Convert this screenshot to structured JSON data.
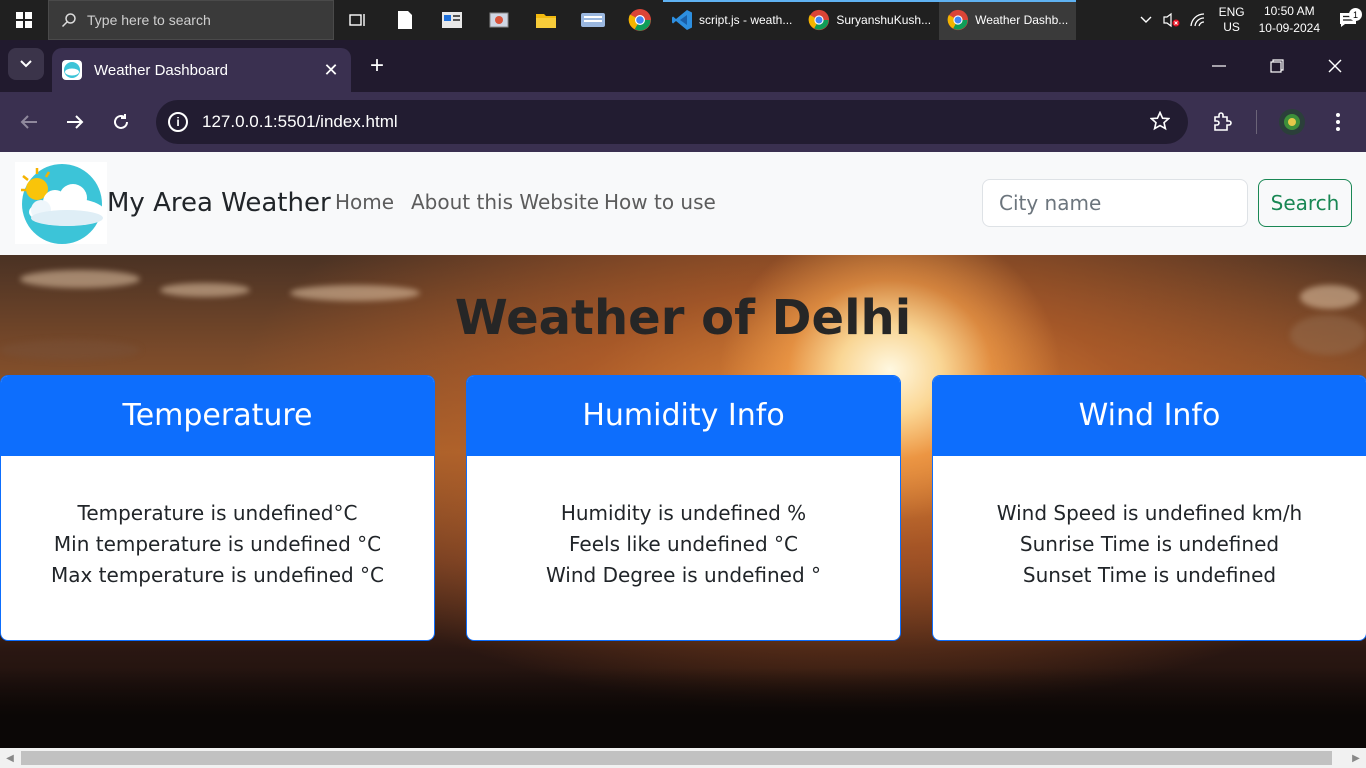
{
  "taskbar": {
    "search_placeholder": "Type here to search",
    "apps": [
      {
        "label": "script.js - weath..."
      },
      {
        "label": "SuryanshuKush..."
      },
      {
        "label": "Weather Dashb..."
      }
    ],
    "lang_line1": "ENG",
    "lang_line2": "US",
    "time": "10:50 AM",
    "date": "10-09-2024",
    "notification_count": "1"
  },
  "browser": {
    "tab_title": "Weather Dashboard",
    "url": "127.0.0.1:5501/index.html"
  },
  "navbar": {
    "brand": "My Area Weather",
    "links": [
      "Home",
      "About this Website",
      "How to use"
    ],
    "search_placeholder": "City name",
    "search_button": "Search"
  },
  "hero": {
    "title": "Weather of Delhi"
  },
  "cards": [
    {
      "header": "Temperature",
      "lines": [
        "Temperature is undefined°C",
        "Min temperature is undefined °C",
        "Max temperature is undefined °C"
      ]
    },
    {
      "header": "Humidity Info",
      "lines": [
        "Humidity is undefined %",
        "Feels like undefined °C",
        "Wind Degree is undefined °"
      ]
    },
    {
      "header": "Wind Info",
      "lines": [
        "Wind Speed is undefined km/h",
        "Sunrise Time is undefined",
        "Sunset Time is undefined"
      ]
    }
  ],
  "colors": {
    "card_header": "#0d6efd",
    "search_button": "#198754",
    "navbar_bg": "#f8f9fa"
  }
}
